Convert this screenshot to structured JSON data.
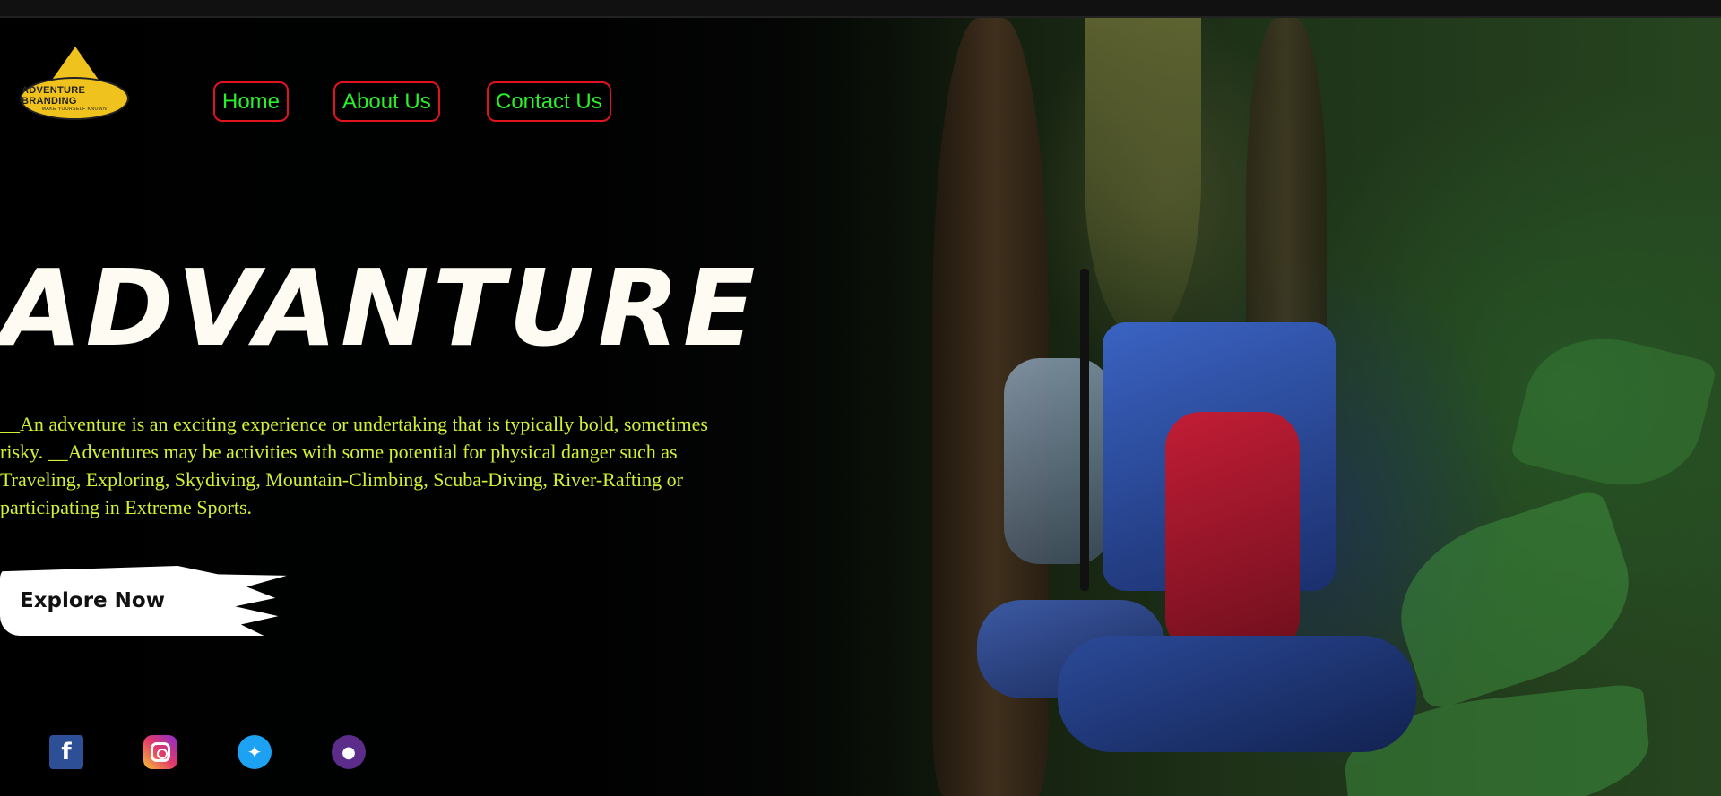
{
  "page": {
    "accent_nav_text": "#2af02a",
    "nav_border": "#e0141e",
    "title_color": "#fdfbf2",
    "desc_color": "#d4f035"
  },
  "logo": {
    "line1": "ADVENTURE BRANDING",
    "line2": "MAKE YOURSELF KNOWN"
  },
  "nav": {
    "items": [
      {
        "label": "Home"
      },
      {
        "label": "About Us"
      },
      {
        "label": "Contact Us"
      }
    ]
  },
  "hero": {
    "title": "ADVANTURE",
    "description": "__An adventure is an exciting experience or undertaking that is typically bold, sometimes risky. __Adventures may be activities with some potential for physical danger such as Traveling, Exploring, Skydiving, Mountain-Climbing, Scuba-Diving, River-Rafting or participating in Extreme Sports.",
    "cta_label": "Explore Now"
  },
  "social": {
    "icons": [
      "facebook-icon",
      "instagram-icon",
      "twitter-icon",
      "github-icon"
    ]
  }
}
